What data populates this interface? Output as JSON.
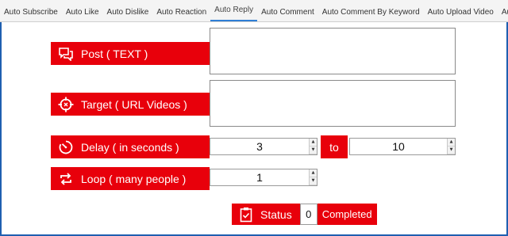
{
  "tabs": [
    {
      "label": "Auto Subscribe"
    },
    {
      "label": "Auto Like"
    },
    {
      "label": "Auto Dislike"
    },
    {
      "label": "Auto Reaction"
    },
    {
      "label": "Auto Reply"
    },
    {
      "label": "Auto Comment"
    },
    {
      "label": "Auto Comment By Keyword"
    },
    {
      "label": "Auto Upload Video"
    },
    {
      "label": "Auto Scrap"
    }
  ],
  "active_tab": "Auto Reply",
  "form": {
    "post_label": "Post ( TEXT )",
    "post_value": "",
    "target_label": "Target ( URL Videos )",
    "target_value": "",
    "delay_label": "Delay ( in seconds )",
    "delay_from": "3",
    "to_label": "to",
    "delay_to": "10",
    "loop_label": "Loop ( many people )",
    "loop_value": "1"
  },
  "status": {
    "label": "Status",
    "count": "0",
    "text": "Completed"
  },
  "colors": {
    "accent_red": "#e8000b",
    "tab_active_underline": "#2f7fd6",
    "frame_blue": "#1f5fb0"
  },
  "icons": {
    "post": "chat-bubbles-icon",
    "target": "crosshair-target-icon",
    "delay": "timer-icon",
    "loop": "repeat-icon",
    "status": "clipboard-check-icon"
  }
}
